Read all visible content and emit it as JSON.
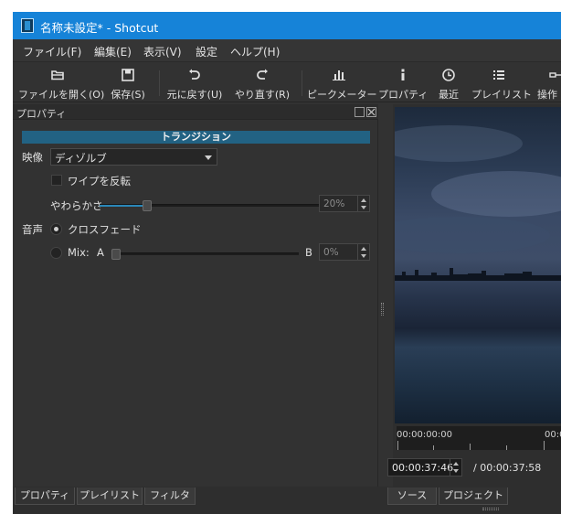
{
  "window": {
    "title": "名称未設定* - Shotcut"
  },
  "menu": {
    "items": [
      "ファイル(F)",
      "編集(E)",
      "表示(V)",
      "設定",
      "ヘルプ(H)"
    ]
  },
  "toolbar": {
    "open_label": "ファイルを開く(O)",
    "save_label": "保存(S)",
    "undo_label": "元に戻す(U)",
    "redo_label": "やり直す(R)",
    "peak_label": "ピークメーター",
    "properties_label": "プロパティ",
    "recent_label": "最近",
    "playlist_label": "プレイリスト",
    "ops_label": "操作"
  },
  "properties_panel": {
    "title": "プロパティ",
    "banner": "トランジション",
    "video_label": "映像",
    "video_value": "ディゾルブ",
    "wipe_reverse_label": "ワイプを反転",
    "wipe_reverse_checked": false,
    "softness_label": "やわらかさ",
    "softness_value": "20%",
    "softness_fraction": 0.2,
    "audio_label": "音声",
    "crossfade_label": "クロスフェード",
    "crossfade_selected": true,
    "mix_label": "Mix:",
    "mix_a": "A",
    "mix_b": "B",
    "mix_value": "0%",
    "mix_fraction": 0.0
  },
  "left_tabs": [
    "プロパティ",
    "プレイリスト",
    "フィルタ"
  ],
  "preview": {
    "ruler_start": "00:00:00:00",
    "ruler_next": "00:0",
    "current_time": "00:00:37:46",
    "total_time": "/ 00:00:37:58"
  },
  "right_tabs": [
    "ソース",
    "プロジェクト"
  ],
  "colors": {
    "titlebar": "#1683d8",
    "accent": "#2a87b8",
    "banner": "#226283",
    "background": "#323232"
  }
}
